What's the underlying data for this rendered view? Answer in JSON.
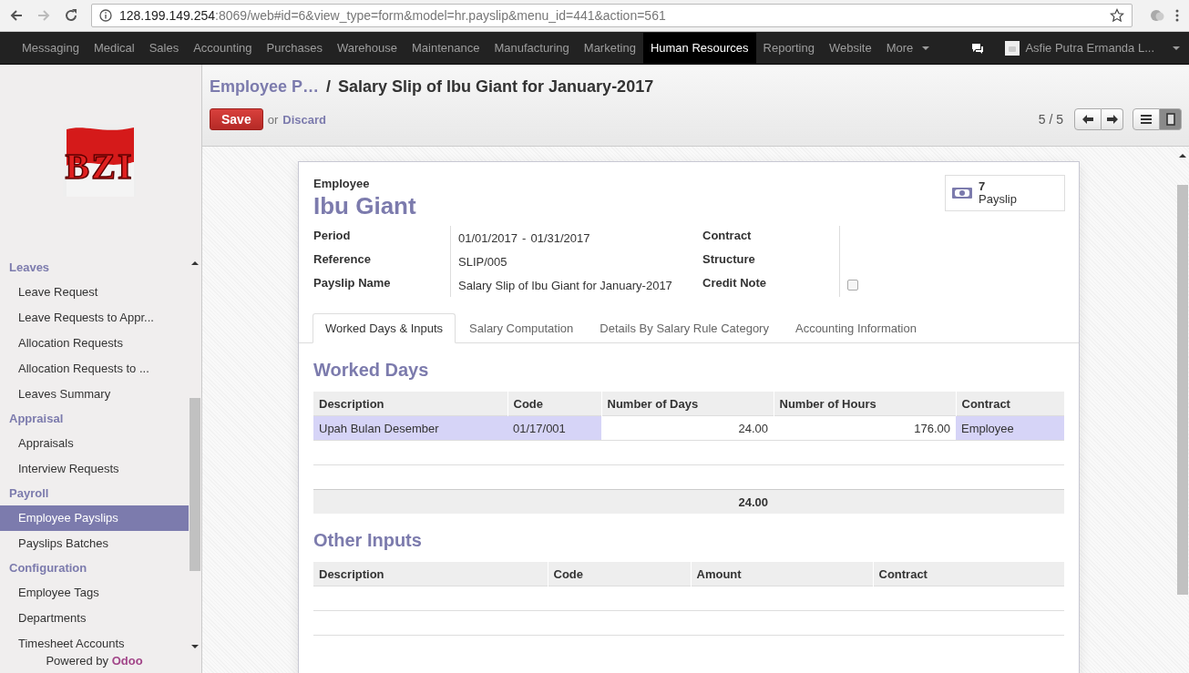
{
  "browser": {
    "url_host": "128.199.149.254",
    "url_path": ":8069/web#id=6&view_type=form&model=hr.payslip&menu_id=441&action=561"
  },
  "top_menu": [
    {
      "label": "Messaging",
      "selected": false
    },
    {
      "label": "Medical",
      "selected": false
    },
    {
      "label": "Sales",
      "selected": false
    },
    {
      "label": "Accounting",
      "selected": false
    },
    {
      "label": "Purchases",
      "selected": false
    },
    {
      "label": "Warehouse",
      "selected": false
    },
    {
      "label": "Maintenance",
      "selected": false
    },
    {
      "label": "Manufacturing",
      "selected": false
    },
    {
      "label": "Marketing",
      "selected": false
    },
    {
      "label": "Human Resources",
      "selected": true
    },
    {
      "label": "Reporting",
      "selected": false
    },
    {
      "label": "Website",
      "selected": false
    }
  ],
  "more_menu": "More",
  "user": "Asfie Putra Ermanda L...",
  "sidebar": {
    "logo_text": "BZI",
    "sections": [
      {
        "title": "Leaves",
        "items": [
          {
            "label": "Leave Request",
            "selected": false
          },
          {
            "label": "Leave Requests to Appr...",
            "selected": false
          },
          {
            "label": "Allocation Requests",
            "selected": false
          },
          {
            "label": "Allocation Requests to ...",
            "selected": false
          },
          {
            "label": "Leaves Summary",
            "selected": false
          }
        ]
      },
      {
        "title": "Appraisal",
        "items": [
          {
            "label": "Appraisals",
            "selected": false
          },
          {
            "label": "Interview Requests",
            "selected": false
          }
        ]
      },
      {
        "title": "Payroll",
        "items": [
          {
            "label": "Employee Payslips",
            "selected": true
          },
          {
            "label": "Payslips Batches",
            "selected": false
          }
        ]
      },
      {
        "title": "Configuration",
        "items": [
          {
            "label": "Employee Tags",
            "selected": false
          },
          {
            "label": "Departments",
            "selected": false
          },
          {
            "label": "Timesheet Accounts",
            "selected": false
          }
        ]
      }
    ],
    "powered_by": "Powered by",
    "powered_brand": "Odoo"
  },
  "breadcrumb": {
    "parent": "Employee P…",
    "separator": "/",
    "current": "Salary Slip of Ibu Giant for January-2017"
  },
  "actions": {
    "save": "Save",
    "or": "or",
    "discard": "Discard"
  },
  "pager": "5 / 5",
  "views": [
    {
      "kind": "list",
      "selected": false
    },
    {
      "kind": "form",
      "selected": true
    }
  ],
  "form": {
    "employee_label": "Employee",
    "employee_name": "Ibu Giant",
    "smart_button": {
      "count": "7",
      "label": "Payslip"
    },
    "fields_left": [
      {
        "label": "Period",
        "value": "01/01/2017",
        "range_separator": "-",
        "value_end": "01/31/2017"
      },
      {
        "label": "Reference",
        "value": "SLIP/005"
      },
      {
        "label": "Payslip Name",
        "value": "Salary Slip of Ibu Giant for January-2017"
      }
    ],
    "fields_right": [
      {
        "label": "Contract",
        "kind": "text"
      },
      {
        "label": "Structure",
        "kind": "text"
      },
      {
        "label": "Credit Note",
        "kind": "checkbox",
        "checked": false
      }
    ],
    "tabs": [
      {
        "label": "Worked Days & Inputs",
        "selected": true
      },
      {
        "label": "Salary Computation",
        "selected": false
      },
      {
        "label": "Details By Salary Rule Category",
        "selected": false
      },
      {
        "label": "Accounting Information",
        "selected": false
      }
    ],
    "worked_days": {
      "title": "Worked Days",
      "columns": [
        {
          "label": "Description"
        },
        {
          "label": "Code"
        },
        {
          "label": "Number of Days",
          "total": "24.00"
        },
        {
          "label": "Number of Hours"
        },
        {
          "label": "Contract"
        }
      ],
      "rows": [
        {
          "cells": [
            "Upah Bulan Desember",
            "01/17/001",
            "24.00",
            "176.00",
            "Employee"
          ],
          "selected": true
        }
      ]
    },
    "other_inputs": {
      "title": "Other Inputs",
      "columns": [
        {
          "label": "Description"
        },
        {
          "label": "Code"
        },
        {
          "label": "Amount"
        },
        {
          "label": "Contract"
        }
      ]
    }
  }
}
